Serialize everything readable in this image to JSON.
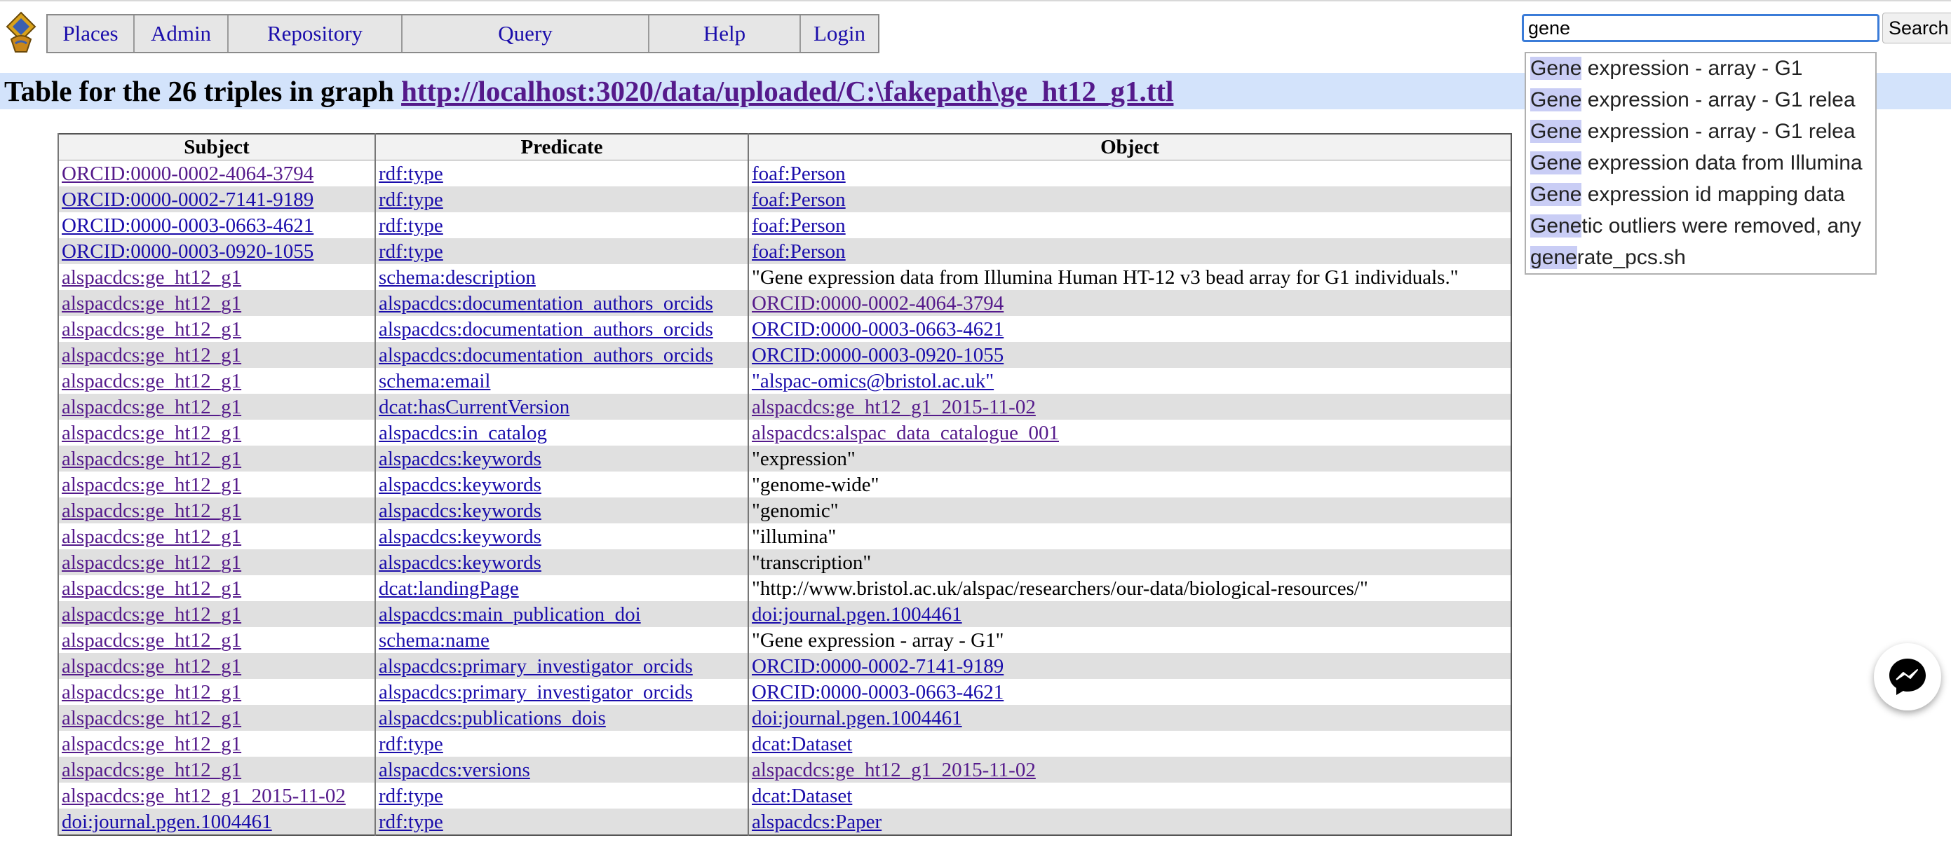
{
  "menu": [
    "Places",
    "Admin",
    "Repository",
    "Query",
    "Help",
    "Login"
  ],
  "search": {
    "value": "gene",
    "button_label": "Search"
  },
  "autocomplete": [
    {
      "hl": "Gene",
      "rest": " expression - array - G1"
    },
    {
      "hl": "Gene",
      "rest": " expression - array - G1 relea"
    },
    {
      "hl": "Gene",
      "rest": " expression - array - G1 relea"
    },
    {
      "hl": "Gene",
      "rest": " expression data from Illumina"
    },
    {
      "hl": "Gene",
      "rest": " expression id mapping data"
    },
    {
      "hl": "Gene",
      "rest": "tic outliers were removed, any"
    },
    {
      "hl": "gene",
      "rest": "rate_pcs.sh"
    }
  ],
  "page_title": {
    "prefix": "Table for the 26 triples in graph ",
    "graph_link": "http://localhost:3020/data/uploaded/C:\\fakepath\\ge_ht12_g1.ttl"
  },
  "table": {
    "headers": [
      "Subject",
      "Predicate",
      "Object"
    ],
    "rows": [
      [
        {
          "text": "ORCID:0000-0002-4064-3794",
          "link": true,
          "visited": true
        },
        {
          "text": "rdf:type",
          "link": true
        },
        {
          "text": "foaf:Person",
          "link": true
        }
      ],
      [
        {
          "text": "ORCID:0000-0002-7141-9189",
          "link": true
        },
        {
          "text": "rdf:type",
          "link": true
        },
        {
          "text": "foaf:Person",
          "link": true
        }
      ],
      [
        {
          "text": "ORCID:0000-0003-0663-4621",
          "link": true
        },
        {
          "text": "rdf:type",
          "link": true
        },
        {
          "text": "foaf:Person",
          "link": true
        }
      ],
      [
        {
          "text": "ORCID:0000-0003-0920-1055",
          "link": true
        },
        {
          "text": "rdf:type",
          "link": true
        },
        {
          "text": "foaf:Person",
          "link": true
        }
      ],
      [
        {
          "text": "alspacdcs:ge_ht12_g1",
          "link": true,
          "visited": true
        },
        {
          "text": "schema:description",
          "link": true
        },
        {
          "text": "\"Gene expression data from Illumina Human HT-12 v3 bead array for G1 individuals.\"",
          "link": false
        }
      ],
      [
        {
          "text": "alspacdcs:ge_ht12_g1",
          "link": true,
          "visited": true
        },
        {
          "text": "alspacdcs:documentation_authors_orcids",
          "link": true
        },
        {
          "text": "ORCID:0000-0002-4064-3794",
          "link": true,
          "visited": true
        }
      ],
      [
        {
          "text": "alspacdcs:ge_ht12_g1",
          "link": true,
          "visited": true
        },
        {
          "text": "alspacdcs:documentation_authors_orcids",
          "link": true
        },
        {
          "text": "ORCID:0000-0003-0663-4621",
          "link": true
        }
      ],
      [
        {
          "text": "alspacdcs:ge_ht12_g1",
          "link": true,
          "visited": true
        },
        {
          "text": "alspacdcs:documentation_authors_orcids",
          "link": true
        },
        {
          "text": "ORCID:0000-0003-0920-1055",
          "link": true
        }
      ],
      [
        {
          "text": "alspacdcs:ge_ht12_g1",
          "link": true,
          "visited": true
        },
        {
          "text": "schema:email",
          "link": true
        },
        {
          "text": "\"alspac-omics@bristol.ac.uk\"",
          "link": true
        }
      ],
      [
        {
          "text": "alspacdcs:ge_ht12_g1",
          "link": true,
          "visited": true
        },
        {
          "text": "dcat:hasCurrentVersion",
          "link": true
        },
        {
          "text": "alspacdcs:ge_ht12_g1_2015-11-02",
          "link": true,
          "visited": true
        }
      ],
      [
        {
          "text": "alspacdcs:ge_ht12_g1",
          "link": true,
          "visited": true
        },
        {
          "text": "alspacdcs:in_catalog",
          "link": true
        },
        {
          "text": "alspacdcs:alspac_data_catalogue_001",
          "link": true,
          "visited": true
        }
      ],
      [
        {
          "text": "alspacdcs:ge_ht12_g1",
          "link": true,
          "visited": true
        },
        {
          "text": "alspacdcs:keywords",
          "link": true
        },
        {
          "text": "\"expression\"",
          "link": false
        }
      ],
      [
        {
          "text": "alspacdcs:ge_ht12_g1",
          "link": true,
          "visited": true
        },
        {
          "text": "alspacdcs:keywords",
          "link": true
        },
        {
          "text": "\"genome-wide\"",
          "link": false
        }
      ],
      [
        {
          "text": "alspacdcs:ge_ht12_g1",
          "link": true,
          "visited": true
        },
        {
          "text": "alspacdcs:keywords",
          "link": true
        },
        {
          "text": "\"genomic\"",
          "link": false
        }
      ],
      [
        {
          "text": "alspacdcs:ge_ht12_g1",
          "link": true,
          "visited": true
        },
        {
          "text": "alspacdcs:keywords",
          "link": true
        },
        {
          "text": "\"illumina\"",
          "link": false
        }
      ],
      [
        {
          "text": "alspacdcs:ge_ht12_g1",
          "link": true,
          "visited": true
        },
        {
          "text": "alspacdcs:keywords",
          "link": true
        },
        {
          "text": "\"transcription\"",
          "link": false
        }
      ],
      [
        {
          "text": "alspacdcs:ge_ht12_g1",
          "link": true,
          "visited": true
        },
        {
          "text": "dcat:landingPage",
          "link": true
        },
        {
          "text": "\"http://www.bristol.ac.uk/alspac/researchers/our-data/biological-resources/\"",
          "link": false
        }
      ],
      [
        {
          "text": "alspacdcs:ge_ht12_g1",
          "link": true,
          "visited": true
        },
        {
          "text": "alspacdcs:main_publication_doi",
          "link": true
        },
        {
          "text": "doi:journal.pgen.1004461",
          "link": true
        }
      ],
      [
        {
          "text": "alspacdcs:ge_ht12_g1",
          "link": true,
          "visited": true
        },
        {
          "text": "schema:name",
          "link": true
        },
        {
          "text": "\"Gene expression - array - G1\"",
          "link": false
        }
      ],
      [
        {
          "text": "alspacdcs:ge_ht12_g1",
          "link": true,
          "visited": true
        },
        {
          "text": "alspacdcs:primary_investigator_orcids",
          "link": true
        },
        {
          "text": "ORCID:0000-0002-7141-9189",
          "link": true
        }
      ],
      [
        {
          "text": "alspacdcs:ge_ht12_g1",
          "link": true,
          "visited": true
        },
        {
          "text": "alspacdcs:primary_investigator_orcids",
          "link": true
        },
        {
          "text": "ORCID:0000-0003-0663-4621",
          "link": true
        }
      ],
      [
        {
          "text": "alspacdcs:ge_ht12_g1",
          "link": true,
          "visited": true
        },
        {
          "text": "alspacdcs:publications_dois",
          "link": true
        },
        {
          "text": "doi:journal.pgen.1004461",
          "link": true
        }
      ],
      [
        {
          "text": "alspacdcs:ge_ht12_g1",
          "link": true,
          "visited": true
        },
        {
          "text": "rdf:type",
          "link": true
        },
        {
          "text": "dcat:Dataset",
          "link": true
        }
      ],
      [
        {
          "text": "alspacdcs:ge_ht12_g1",
          "link": true,
          "visited": true
        },
        {
          "text": "alspacdcs:versions",
          "link": true
        },
        {
          "text": "alspacdcs:ge_ht12_g1_2015-11-02",
          "link": true,
          "visited": true
        }
      ],
      [
        {
          "text": "alspacdcs:ge_ht12_g1_2015-11-02",
          "link": true,
          "visited": true
        },
        {
          "text": "rdf:type",
          "link": true
        },
        {
          "text": "dcat:Dataset",
          "link": true
        }
      ],
      [
        {
          "text": "doi:journal.pgen.1004461",
          "link": true
        },
        {
          "text": "rdf:type",
          "link": true
        },
        {
          "text": "alspacdcs:Paper",
          "link": true
        }
      ]
    ]
  },
  "colors": {
    "link": "#1a0dab",
    "visited_link": "#551a8b",
    "title_bar": "#d3e3fb",
    "autocomplete_highlight": "#c9cdf5",
    "row_alt": "#e0e0e0"
  },
  "icons": {
    "logo": "swish-logo-icon",
    "chat": "messenger-chat-icon"
  }
}
